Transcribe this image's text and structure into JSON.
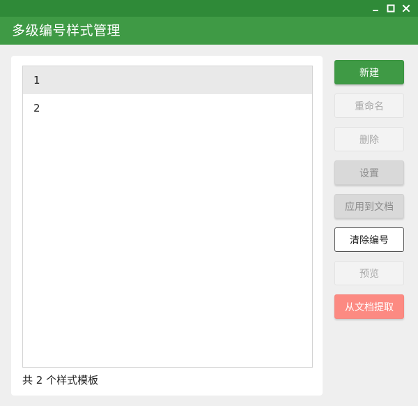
{
  "window": {
    "title": "多级编号样式管理",
    "controls": {
      "minimize_icon": "minimize-icon",
      "maximize_icon": "maximize-icon",
      "close_icon": "close-icon"
    },
    "colors": {
      "titlebar": "#3f9a45",
      "titlebar_strip": "#2f8a38",
      "accent": "#3f9a45",
      "danger": "#fc8a82"
    }
  },
  "list": {
    "items": [
      {
        "label": "1",
        "selected": true
      },
      {
        "label": "2",
        "selected": false
      }
    ],
    "count_text": "共 2 个样式模板"
  },
  "buttons": {
    "new": "新建",
    "rename": "重命名",
    "delete": "删除",
    "settings": "设置",
    "apply_to_document": "应用到文档",
    "clear_numbering": "清除编号",
    "preview": "预览",
    "extract_from_document": "从文档提取"
  }
}
